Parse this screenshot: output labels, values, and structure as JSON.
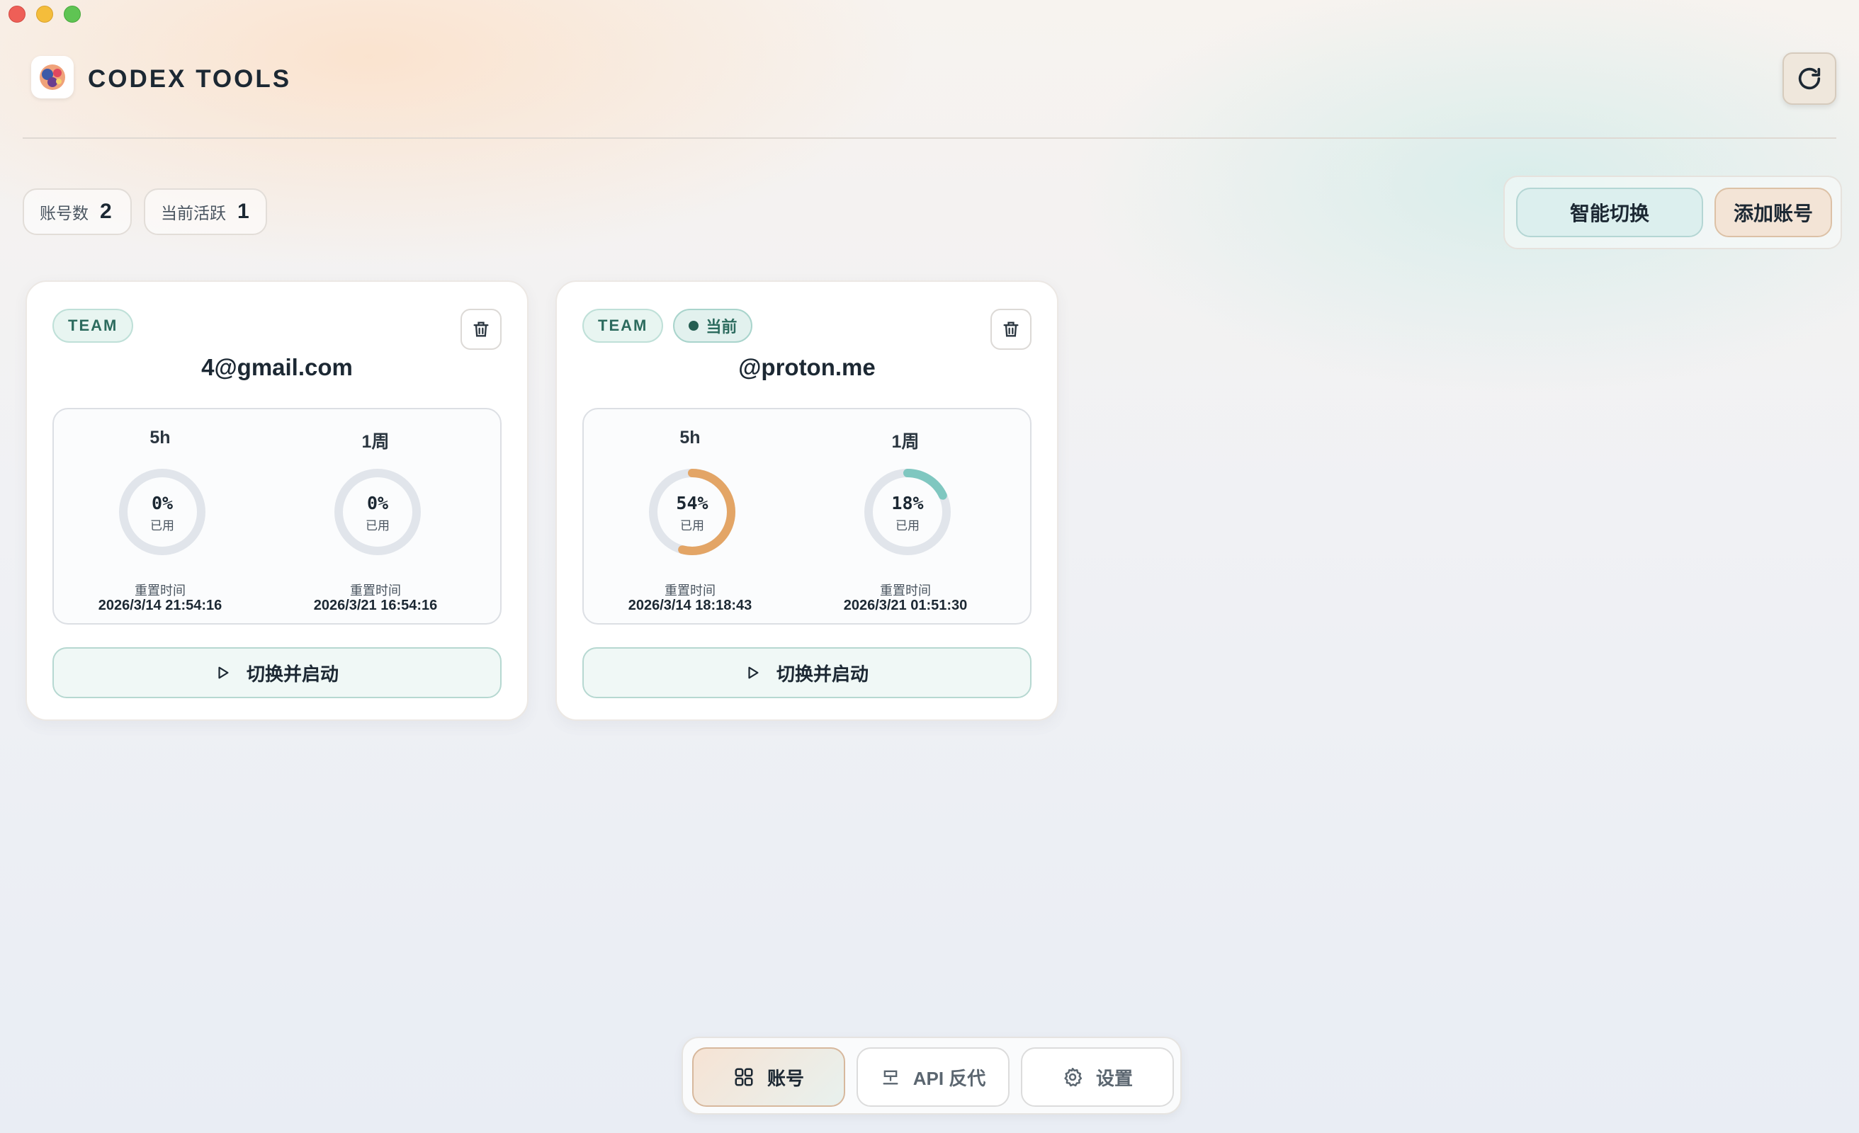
{
  "app": {
    "title": "CODEX TOOLS"
  },
  "stats": {
    "accounts_label": "账号数",
    "accounts_value": "2",
    "active_label": "当前活跃",
    "active_value": "1"
  },
  "actions": {
    "smart_switch": "智能切换",
    "add_account": "添加账号"
  },
  "accounts": [
    {
      "plan": "TEAM",
      "current": false,
      "email": "4@gmail.com",
      "usage": [
        {
          "period": "5h",
          "percent": "0%",
          "percent_value": 0,
          "used_label": "已用",
          "reset_label": "重置时间",
          "reset_time": "2026/3/14 21:54:16"
        },
        {
          "period": "1周",
          "percent": "0%",
          "percent_value": 0,
          "used_label": "已用",
          "reset_label": "重置时间",
          "reset_time": "2026/3/21 16:54:16"
        }
      ],
      "launch_label": "切换并启动"
    },
    {
      "plan": "TEAM",
      "current": true,
      "current_label": "当前",
      "email": "@proton.me",
      "usage": [
        {
          "period": "5h",
          "percent": "54%",
          "percent_value": 54,
          "used_label": "已用",
          "reset_label": "重置时间",
          "reset_time": "2026/3/14 18:18:43"
        },
        {
          "period": "1周",
          "percent": "18%",
          "percent_value": 18,
          "used_label": "已用",
          "reset_label": "重置时间",
          "reset_time": "2026/3/21 01:51:30"
        }
      ],
      "launch_label": "切换并启动"
    }
  ],
  "nav": {
    "accounts": "账号",
    "api_proxy": "API 反代",
    "settings": "设置"
  },
  "icons": {
    "refresh": "refresh-icon",
    "delete": "trash-icon",
    "play": "play-icon",
    "grid": "grid-icon",
    "api": "api-icon",
    "gear": "gear-icon"
  },
  "colors": {
    "ring_track": "#e1e5eb",
    "ring_5h": "#e3a566",
    "ring_week": "#7fc7c0",
    "accent_teal": "#b6d8d1",
    "accent_peach": "#f3e4d6"
  }
}
